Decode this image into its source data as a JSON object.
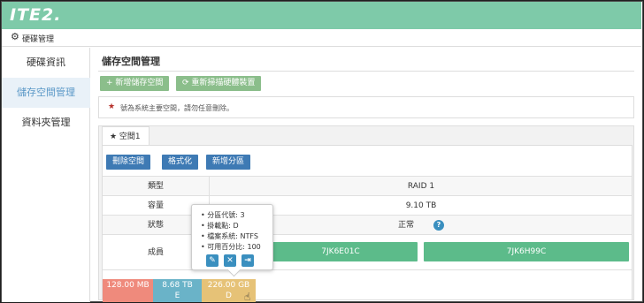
{
  "header": {
    "logo": "ITE2."
  },
  "breadcrumb": {
    "label": "硬碟管理"
  },
  "sidebar": {
    "items": [
      {
        "label": "硬碟資訊",
        "active": false
      },
      {
        "label": "儲存空間管理",
        "active": true
      },
      {
        "label": "資料夾管理",
        "active": false
      }
    ]
  },
  "main": {
    "title": "儲存空間管理",
    "buttons": {
      "add_space": "+ 新增儲存空間",
      "rescan": "⟳ 重新掃描硬體裝置"
    },
    "notice": {
      "star": "★",
      "text": "號為系統主要空間，請勿任意刪除。"
    },
    "tab": {
      "label": "★ 空間1"
    },
    "actions": {
      "delete": "刪除空間",
      "format": "格式化",
      "add_partition": "新增分區"
    },
    "table": {
      "type_label": "類型",
      "type_value": "RAID 1",
      "capacity_label": "容量",
      "capacity_value": "9.10 TB",
      "status_label": "狀態",
      "status_value": "正常",
      "members_label": "成員",
      "members": [
        "7JK6E01C",
        "7JK6H99C"
      ]
    },
    "partitions": [
      {
        "size": "128.00 MB",
        "letter": "",
        "color": "#ef8a7c",
        "fraction": 0.118
      },
      {
        "size": "8.68 TB",
        "letter": "E",
        "color": "#6ab3c8",
        "fraction": 0.094
      },
      {
        "size": "226.00 GB",
        "letter": "D",
        "color": "#e6c277",
        "fraction": 0.106
      }
    ],
    "popover": {
      "lines": [
        "分區代號: 3",
        "掛載點: D",
        "檔案系統: NTFS",
        "可用百分比: 100"
      ],
      "icons": [
        "edit-icon",
        "delete-icon",
        "unmount-icon"
      ]
    }
  },
  "colors": {
    "topbar": "#7ecaa9",
    "green_button": "#8bbe8b",
    "blue_button": "#3e7ab4",
    "member": "#5cbb8a"
  }
}
